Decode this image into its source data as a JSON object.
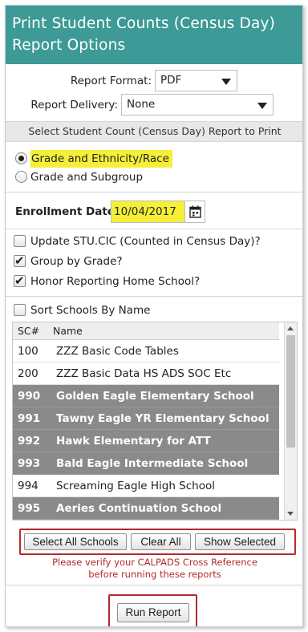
{
  "header": {
    "title": "Print Student Counts (Census Day) Report Options"
  },
  "options": {
    "format_label": "Report Format:",
    "format_value": "PDF",
    "delivery_label": "Report Delivery:",
    "delivery_value": "None"
  },
  "section_title": "Select Student Count (Census Day) Report to Print",
  "report_types": [
    {
      "label": "Grade and Ethnicity/Race",
      "checked": true,
      "highlighted": true
    },
    {
      "label": "Grade and Subgroup",
      "checked": false,
      "highlighted": false
    }
  ],
  "enrollment": {
    "label": "Enrollment Date:",
    "value": "10/04/2017"
  },
  "checkboxes": [
    {
      "label": "Update STU.CIC (Counted in Census Day)?",
      "checked": false
    },
    {
      "label": "Group by Grade?",
      "checked": true
    },
    {
      "label": "Honor Reporting Home School?",
      "checked": true
    }
  ],
  "sort_schools": {
    "label": "Sort Schools By Name",
    "checked": false
  },
  "schools_table": {
    "columns": [
      "SC#",
      "Name"
    ],
    "rows": [
      {
        "sc": "100",
        "name": "ZZZ Basic Code Tables",
        "selected": false
      },
      {
        "sc": "200",
        "name": "ZZZ Basic Data HS ADS SOC Etc",
        "selected": false
      },
      {
        "sc": "990",
        "name": "Golden Eagle Elementary School",
        "selected": true
      },
      {
        "sc": "991",
        "name": "Tawny Eagle YR Elementary School",
        "selected": true
      },
      {
        "sc": "992",
        "name": "Hawk Elementary for ATT",
        "selected": true
      },
      {
        "sc": "993",
        "name": "Bald Eagle Intermediate School",
        "selected": true
      },
      {
        "sc": "994",
        "name": "Screaming Eagle High School",
        "selected": false
      },
      {
        "sc": "995",
        "name": "Aeries Continuation School",
        "selected": true
      }
    ]
  },
  "buttons": {
    "select_all": "Select All Schools",
    "clear_all": "Clear All",
    "show_selected": "Show Selected",
    "run_report": "Run Report"
  },
  "warning": {
    "line1": "Please verify your CALPADS Cross Reference",
    "line2": "before running these reports"
  },
  "colors": {
    "header": "#3d9a96",
    "highlight": "#f5ef3a",
    "selected_row": "#8a8a8a",
    "alert": "#b52a2a"
  }
}
